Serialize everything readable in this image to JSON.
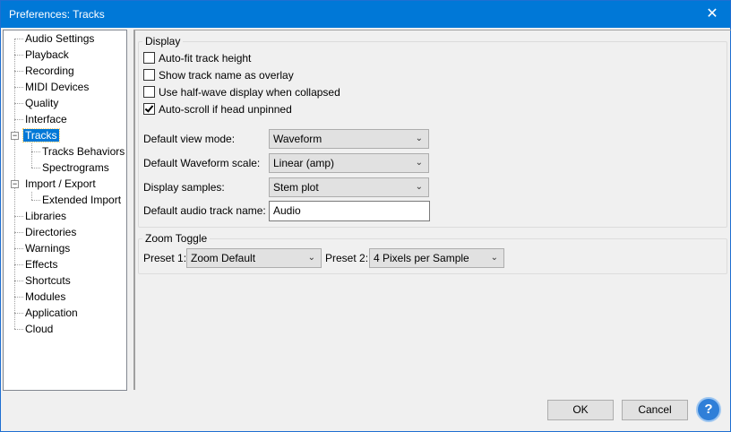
{
  "window": {
    "title": "Preferences: Tracks",
    "close_glyph": "✕"
  },
  "tree": {
    "items": [
      {
        "label": "Audio Settings"
      },
      {
        "label": "Playback"
      },
      {
        "label": "Recording"
      },
      {
        "label": "MIDI Devices"
      },
      {
        "label": "Quality"
      },
      {
        "label": "Interface"
      },
      {
        "label": "Tracks",
        "selected": true,
        "expander": "−"
      },
      {
        "label": "Tracks Behaviors"
      },
      {
        "label": "Spectrograms"
      },
      {
        "label": "Import / Export",
        "expander": "−"
      },
      {
        "label": "Extended Import"
      },
      {
        "label": "Libraries"
      },
      {
        "label": "Directories"
      },
      {
        "label": "Warnings"
      },
      {
        "label": "Effects"
      },
      {
        "label": "Shortcuts"
      },
      {
        "label": "Modules"
      },
      {
        "label": "Application"
      },
      {
        "label": "Cloud"
      }
    ]
  },
  "display": {
    "title": "Display",
    "checkboxes": [
      {
        "label": "Auto-fit track height",
        "checked": false
      },
      {
        "label": "Show track name as overlay",
        "checked": false
      },
      {
        "label": "Use half-wave display when collapsed",
        "checked": false
      },
      {
        "label": "Auto-scroll if head unpinned",
        "checked": true
      }
    ],
    "view_mode": {
      "label": "Default view mode:",
      "value": "Waveform"
    },
    "waveform_scale": {
      "label": "Default Waveform scale:",
      "value": "Linear (amp)"
    },
    "display_samples": {
      "label": "Display samples:",
      "value": "Stem plot"
    },
    "track_name": {
      "label": "Default audio track name:",
      "value": "Audio"
    }
  },
  "zoom": {
    "title": "Zoom Toggle",
    "preset1": {
      "label": "Preset 1:",
      "value": "Zoom Default"
    },
    "preset2": {
      "label": "Preset 2:",
      "value": "4 Pixels per Sample"
    }
  },
  "buttons": {
    "ok": "OK",
    "cancel": "Cancel",
    "help": "?"
  },
  "icons": {
    "dropdown": "chevron-down-icon",
    "help": "help-icon",
    "close": "close-icon"
  }
}
